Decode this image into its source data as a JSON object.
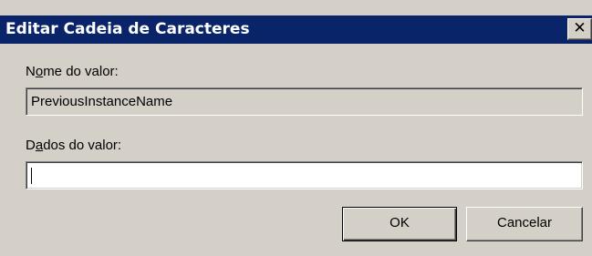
{
  "window": {
    "title": "Editar Cadeia de Caracteres",
    "close_glyph": "✕"
  },
  "fields": {
    "name_label_pre": "N",
    "name_label_accel": "o",
    "name_label_post": "me do valor:",
    "name_value": "PreviousInstanceName",
    "data_label_pre": "D",
    "data_label_accel": "a",
    "data_label_post": "dos do valor:",
    "data_value": ""
  },
  "buttons": {
    "ok_label": "OK",
    "cancel_label": "Cancelar"
  },
  "colors": {
    "title_bar": "#0a246a",
    "face": "#d4d0c8"
  }
}
